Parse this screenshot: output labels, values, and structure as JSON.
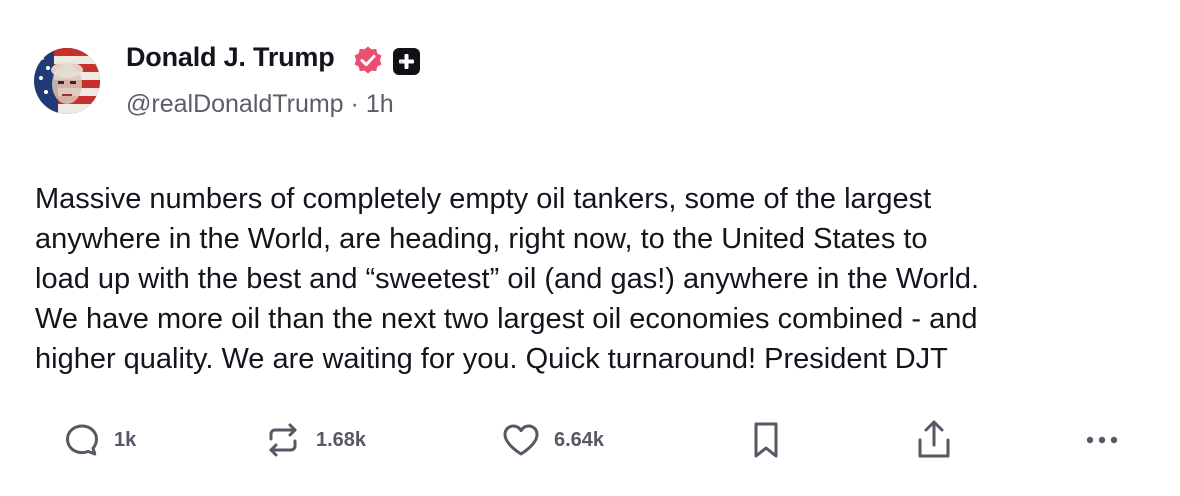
{
  "post": {
    "author_name": "Donald J. Trump",
    "handle": "@realDonaldTrump",
    "separator": "·",
    "time_ago": "1h",
    "body": "Massive numbers of completely empty oil tankers, some of the largest\nanywhere in the World, are heading, right now, to the United States to\nload up with the best and “sweetest” oil (and gas!) anywhere in the World.\nWe have more oil than the next two largest oil economies combined - and\nhigher quality. We are waiting for you. Quick turnaround! President DJT"
  },
  "badges": {
    "verified_icon": "verified-check-icon",
    "verified_color": "#e8506e",
    "plus_icon": "plus-badge-icon"
  },
  "actions": {
    "reply": {
      "icon": "comment-icon",
      "count": "1k"
    },
    "retruth": {
      "icon": "repost-icon",
      "count": "1.68k"
    },
    "like": {
      "icon": "heart-icon",
      "count": "6.64k"
    },
    "bookmark": {
      "icon": "bookmark-icon"
    },
    "share": {
      "icon": "share-icon"
    },
    "more": {
      "icon": "more-icon"
    }
  },
  "colors": {
    "text": "#17131d",
    "muted": "#5f5b67",
    "icon": "#5a5663"
  }
}
